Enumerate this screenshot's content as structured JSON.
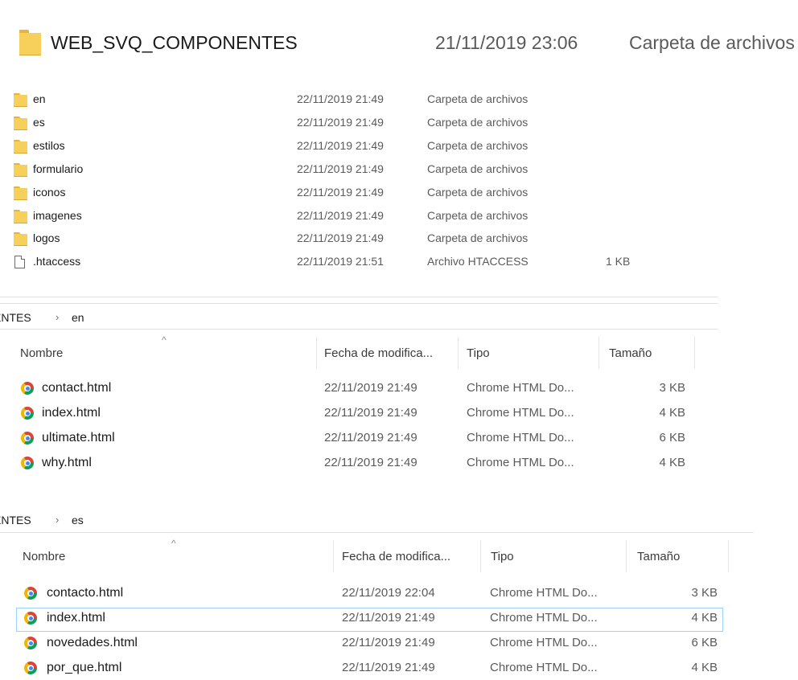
{
  "top": {
    "folder_name": "WEB_SVQ_COMPONENTES",
    "date": "21/11/2019 23:06",
    "type": "Carpeta de archivos"
  },
  "root_list": [
    {
      "name": "en",
      "date": "22/11/2019 21:49",
      "type": "Carpeta de archivos",
      "size": "",
      "icon": "folder-icon"
    },
    {
      "name": "es",
      "date": "22/11/2019 21:49",
      "type": "Carpeta de archivos",
      "size": "",
      "icon": "folder-icon"
    },
    {
      "name": "estilos",
      "date": "22/11/2019 21:49",
      "type": "Carpeta de archivos",
      "size": "",
      "icon": "folder-icon"
    },
    {
      "name": "formulario",
      "date": "22/11/2019 21:49",
      "type": "Carpeta de archivos",
      "size": "",
      "icon": "folder-icon"
    },
    {
      "name": "iconos",
      "date": "22/11/2019 21:49",
      "type": "Carpeta de archivos",
      "size": "",
      "icon": "folder-icon"
    },
    {
      "name": "imagenes",
      "date": "22/11/2019 21:49",
      "type": "Carpeta de archivos",
      "size": "",
      "icon": "folder-icon"
    },
    {
      "name": "logos",
      "date": "22/11/2019 21:49",
      "type": "Carpeta de archivos",
      "size": "",
      "icon": "folder-icon"
    },
    {
      "name": ".htaccess",
      "date": "22/11/2019 21:51",
      "type": "Archivo HTACCESS",
      "size": "1 KB",
      "icon": "file-icon"
    }
  ],
  "en_pane": {
    "breadcrumb_parent": "ENTES",
    "breadcrumb_current": "en",
    "columns": {
      "name": "Nombre",
      "date": "Fecha de modifica...",
      "type": "Tipo",
      "size": "Tamaño"
    },
    "rows": [
      {
        "name": "contact.html",
        "date": "22/11/2019 21:49",
        "type": "Chrome HTML Do...",
        "size": "3 KB"
      },
      {
        "name": "index.html",
        "date": "22/11/2019 21:49",
        "type": "Chrome HTML Do...",
        "size": "4 KB"
      },
      {
        "name": "ultimate.html",
        "date": "22/11/2019 21:49",
        "type": "Chrome HTML Do...",
        "size": "6 KB"
      },
      {
        "name": "why.html",
        "date": "22/11/2019 21:49",
        "type": "Chrome HTML Do...",
        "size": "4 KB"
      }
    ]
  },
  "es_pane": {
    "breadcrumb_parent": "ENTES",
    "breadcrumb_current": "es",
    "columns": {
      "name": "Nombre",
      "date": "Fecha de modifica...",
      "type": "Tipo",
      "size": "Tamaño"
    },
    "rows": [
      {
        "name": "contacto.html",
        "date": "22/11/2019 22:04",
        "type": "Chrome HTML Do...",
        "size": "3 KB"
      },
      {
        "name": "index.html",
        "date": "22/11/2019 21:49",
        "type": "Chrome HTML Do...",
        "size": "4 KB"
      },
      {
        "name": "novedades.html",
        "date": "22/11/2019 21:49",
        "type": "Chrome HTML Do...",
        "size": "6 KB"
      },
      {
        "name": "por_que.html",
        "date": "22/11/2019 21:49",
        "type": "Chrome HTML Do...",
        "size": "4 KB"
      }
    ]
  },
  "colors": {
    "folder": "#f7cf5b",
    "selection_border": "#99d1ff",
    "separator": "#e3e3e3"
  }
}
